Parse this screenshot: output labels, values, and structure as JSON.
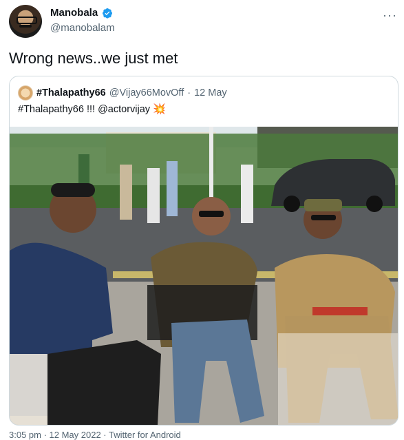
{
  "tweet": {
    "display_name": "Manobala",
    "handle": "@manobalam",
    "text": "Wrong news..we just met",
    "more_label": "···",
    "timestamp": "3:05 pm · 12 May 2022 · Twitter for Android"
  },
  "quoted": {
    "display_name": "#Thalapathy66",
    "handle": "@Vijay66MovOff",
    "separator": "·",
    "date": "12 May",
    "text": "#Thalapathy66 !!! @actorvijay",
    "emoji": "💥"
  },
  "colors": {
    "verified": "#1d9bf0",
    "secondary_text": "#536471",
    "border": "#cfd9de"
  }
}
